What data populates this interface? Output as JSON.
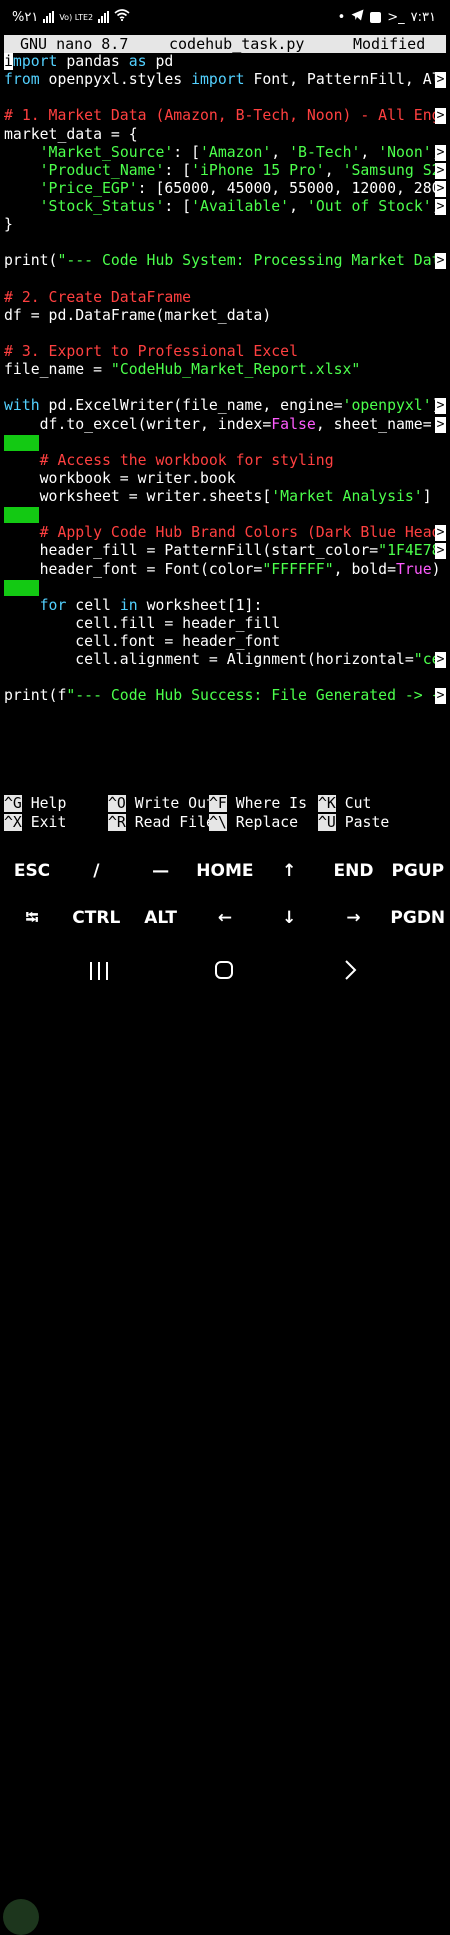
{
  "status_bar": {
    "left_text": "%٢١",
    "network_label": "Vo) LTE2",
    "time": "٧:٣١",
    "terminal_glyph": ">_"
  },
  "nano": {
    "version": "GNU nano 8.7",
    "filename": "codehub_task.py",
    "state": "Modified"
  },
  "code_lines": [
    [
      [
        "i",
        "cursor"
      ],
      [
        "mport",
        "kw"
      ],
      [
        " pandas ",
        ""
      ],
      [
        "as",
        "kw"
      ],
      [
        " pd",
        ""
      ]
    ],
    [
      [
        "from",
        "kw"
      ],
      [
        " openpyxl.styles ",
        ""
      ],
      [
        "import",
        "kw"
      ],
      [
        " Font, PatternFill, Al",
        ""
      ]
    ],
    [],
    [
      [
        "# 1. Market Data (Amazon, B-Tech, Noon) - All Eng",
        "cm"
      ]
    ],
    [
      [
        "market_data = {",
        ""
      ]
    ],
    [
      [
        "    ",
        ""
      ],
      [
        "'Market_Source'",
        "st"
      ],
      [
        ": [",
        ""
      ],
      [
        "'Amazon'",
        "st"
      ],
      [
        ", ",
        ""
      ],
      [
        "'B-Tech'",
        "st"
      ],
      [
        ", ",
        ""
      ],
      [
        "'Noon'",
        "st"
      ],
      [
        ",",
        ""
      ]
    ],
    [
      [
        "    ",
        ""
      ],
      [
        "'Product_Name'",
        "st"
      ],
      [
        ": [",
        ""
      ],
      [
        "'iPhone 15 Pro'",
        "st"
      ],
      [
        ", ",
        ""
      ],
      [
        "'Samsung S2",
        "st"
      ]
    ],
    [
      [
        "    ",
        ""
      ],
      [
        "'Price_EGP'",
        "st"
      ],
      [
        ": [65000, 45000, 55000, 12000, 280",
        ""
      ]
    ],
    [
      [
        "    ",
        ""
      ],
      [
        "'Stock_Status'",
        "st"
      ],
      [
        ": [",
        ""
      ],
      [
        "'Available'",
        "st"
      ],
      [
        ", ",
        ""
      ],
      [
        "'Out of Stock'",
        "st"
      ],
      [
        ",",
        ""
      ]
    ],
    [
      [
        "}",
        ""
      ]
    ],
    [],
    [
      [
        "print(",
        ""
      ],
      [
        "\"--- Code Hub System: Processing Market Dat",
        "st"
      ]
    ],
    [],
    [
      [
        "# 2. Create DataFrame",
        "cm"
      ]
    ],
    [
      [
        "df = pd.DataFrame(market_data)",
        ""
      ]
    ],
    [],
    [
      [
        "# 3. Export to Professional Excel",
        "cm"
      ]
    ],
    [
      [
        "file_name = ",
        ""
      ],
      [
        "\"CodeHub_Market_Report.xlsx\"",
        "st"
      ]
    ],
    [],
    [
      [
        "with",
        "kw"
      ],
      [
        " pd.ExcelWriter(file_name, engine=",
        ""
      ],
      [
        "'openpyxl'",
        "st"
      ],
      [
        ")",
        ""
      ]
    ],
    [
      [
        "    df.to_excel(writer, index=",
        ""
      ],
      [
        "False",
        "kw2"
      ],
      [
        ", sheet_name=",
        ""
      ],
      [
        "'",
        "st"
      ]
    ],
    [
      [
        "",
        "block"
      ]
    ],
    [
      [
        "    ",
        ""
      ],
      [
        "# Access the workbook for styling",
        "cm"
      ]
    ],
    [
      [
        "    workbook = writer.book",
        ""
      ]
    ],
    [
      [
        "    worksheet = writer.sheets[",
        ""
      ],
      [
        "'Market Analysis'",
        "st"
      ],
      [
        "]",
        ""
      ]
    ],
    [
      [
        "",
        "block"
      ]
    ],
    [
      [
        "    ",
        ""
      ],
      [
        "# Apply Code Hub Brand Colors (Dark Blue Head",
        "cm"
      ]
    ],
    [
      [
        "    header_fill = PatternFill(start_color=",
        ""
      ],
      [
        "\"1F4E78",
        "st"
      ]
    ],
    [
      [
        "    header_font = Font(color=",
        ""
      ],
      [
        "\"FFFFFF\"",
        "st"
      ],
      [
        ", bold=",
        ""
      ],
      [
        "True",
        "kw2"
      ],
      [
        ")",
        ""
      ]
    ],
    [
      [
        "",
        "block"
      ]
    ],
    [
      [
        "    ",
        ""
      ],
      [
        "for",
        "kw"
      ],
      [
        " cell ",
        ""
      ],
      [
        "in",
        "kw"
      ],
      [
        " worksheet[1]:",
        ""
      ]
    ],
    [
      [
        "        cell.fill = header_fill",
        ""
      ]
    ],
    [
      [
        "        cell.font = header_font",
        ""
      ]
    ],
    [
      [
        "        cell.alignment = Alignment(horizontal=",
        ""
      ],
      [
        "\"ce",
        "st"
      ]
    ],
    [],
    [
      [
        "print(f",
        ""
      ],
      [
        "\"--- Code Hub Success: File Generated -> {",
        "st"
      ]
    ]
  ],
  "truncated_lines": [
    1,
    3,
    5,
    6,
    7,
    8,
    11,
    19,
    20,
    26,
    27,
    33,
    35
  ],
  "shortcuts": [
    [
      {
        "key": "^G",
        "label": "Help"
      },
      {
        "key": "^O",
        "label": "Write Out"
      },
      {
        "key": "^F",
        "label": "Where Is"
      },
      {
        "key": "^K",
        "label": "Cut"
      }
    ],
    [
      {
        "key": "^X",
        "label": "Exit"
      },
      {
        "key": "^R",
        "label": "Read File"
      },
      {
        "key": "^\\",
        "label": "Replace"
      },
      {
        "key": "^U",
        "label": "Paste"
      }
    ]
  ],
  "extra_keys": [
    [
      "ESC",
      "/",
      "—",
      "HOME",
      "↑",
      "END",
      "PGUP"
    ],
    [
      "⭾",
      "CTRL",
      "ALT",
      "←",
      "↓",
      "→",
      "PGDN"
    ]
  ],
  "truncation_marker": ">"
}
